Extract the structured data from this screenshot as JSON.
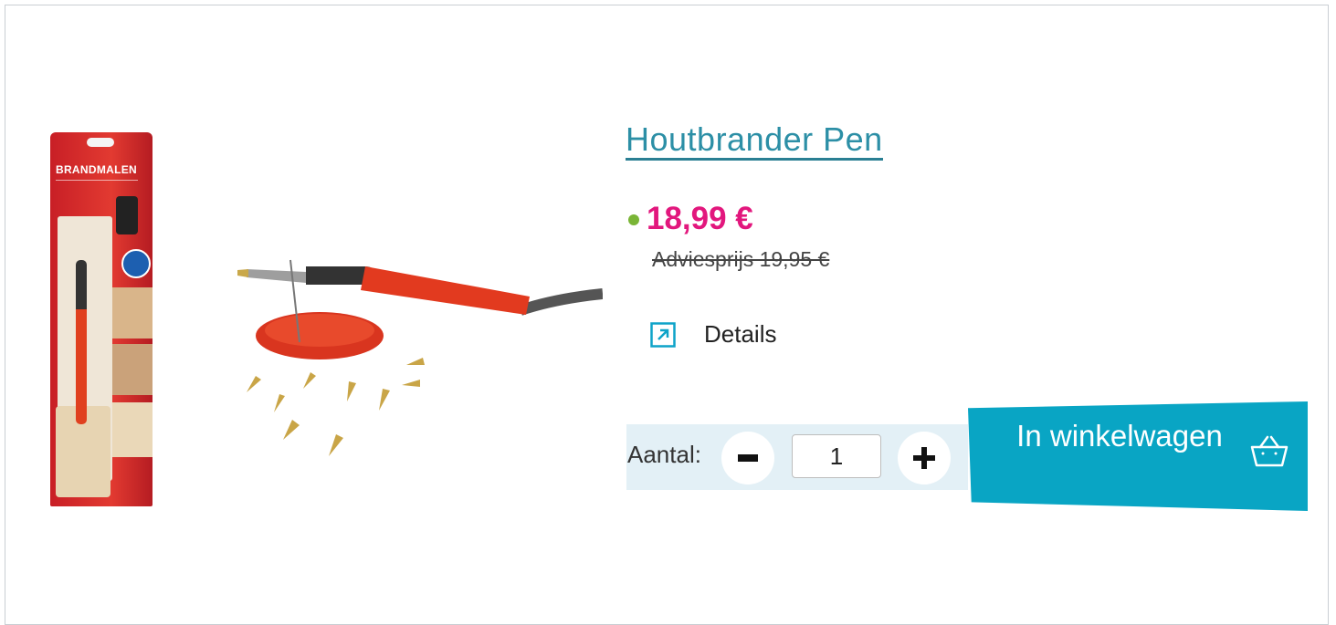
{
  "product": {
    "title": "Houtbrander Pen",
    "price": "18,99 €",
    "old_price": "Adviesprijs 19,95 €",
    "box_text": "BRANDMALEN",
    "availability_color": "#7ab536",
    "price_color": "#e2177d"
  },
  "details": {
    "label": "Details",
    "icon": "external-link-icon"
  },
  "quantity": {
    "label": "Aantal:",
    "value": "1",
    "minus_icon": "minus-icon",
    "plus_icon": "plus-icon"
  },
  "cart": {
    "label": "In winkelwagen",
    "icon": "basket-icon",
    "color": "#09a5c4"
  }
}
